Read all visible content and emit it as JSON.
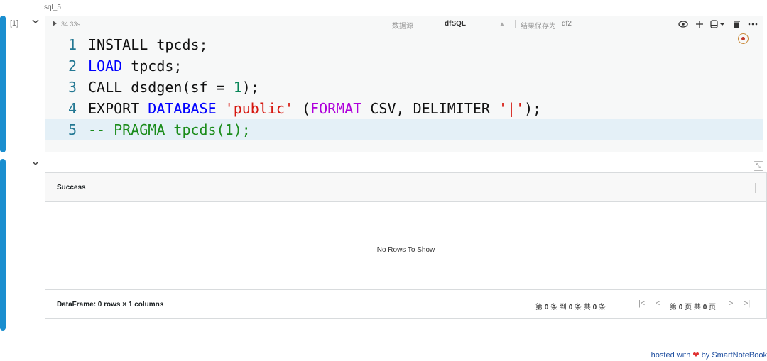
{
  "cell": {
    "name": "sql_5",
    "exec_count": "[1]",
    "elapsed": "34.33s",
    "datasource_label": "数据源",
    "datasource_value": "dfSQL",
    "save_label": "结果保存为",
    "save_value": "df2",
    "toolbar_icons": [
      "eye-icon",
      "plus-icon",
      "database-icon",
      "dropdown-icon",
      "trash-icon",
      "more-icon"
    ],
    "code_lines": [
      {
        "num": "1",
        "tokens": [
          {
            "t": "INSTALL tpcds;",
            "c": "plain"
          }
        ]
      },
      {
        "num": "2",
        "tokens": [
          {
            "t": "LOAD",
            "c": "kw-blue"
          },
          {
            "t": " tpcds;",
            "c": "plain"
          }
        ]
      },
      {
        "num": "3",
        "tokens": [
          {
            "t": "CALL dsdgen(sf = ",
            "c": "plain"
          },
          {
            "t": "1",
            "c": "num"
          },
          {
            "t": ");",
            "c": "plain"
          }
        ]
      },
      {
        "num": "4",
        "tokens": [
          {
            "t": "EXPORT ",
            "c": "plain"
          },
          {
            "t": "DATABASE",
            "c": "kw-blue"
          },
          {
            "t": " ",
            "c": "plain"
          },
          {
            "t": "'public'",
            "c": "str"
          },
          {
            "t": " (",
            "c": "plain"
          },
          {
            "t": "FORMAT",
            "c": "kw-purple"
          },
          {
            "t": " CSV, DELIMITER ",
            "c": "plain"
          },
          {
            "t": "'|'",
            "c": "str"
          },
          {
            "t": ");",
            "c": "plain"
          }
        ]
      },
      {
        "num": "5",
        "tokens": [
          {
            "t": "-- PRAGMA tpcds(1);",
            "c": "cmt"
          }
        ],
        "active": true
      }
    ]
  },
  "output": {
    "column_header": "Success",
    "no_rows": "No Rows To Show",
    "df_info": "DataFrame: 0 rows × 1 columns",
    "pagination": {
      "summary_parts": [
        "第",
        "0",
        "条 到",
        "0",
        "条 共",
        "0",
        "条"
      ],
      "page_parts": [
        "第",
        "0",
        "页 共",
        "0",
        "页"
      ],
      "first": "|<",
      "prev": "<",
      "next": ">",
      "last": ">|"
    }
  },
  "footer": {
    "hosted_prefix": "hosted with",
    "hosted_suffix": "by SmartNoteBook"
  },
  "colors": {
    "accent_bar": "#1a8ecf",
    "editor_border": "#5db0b5"
  }
}
